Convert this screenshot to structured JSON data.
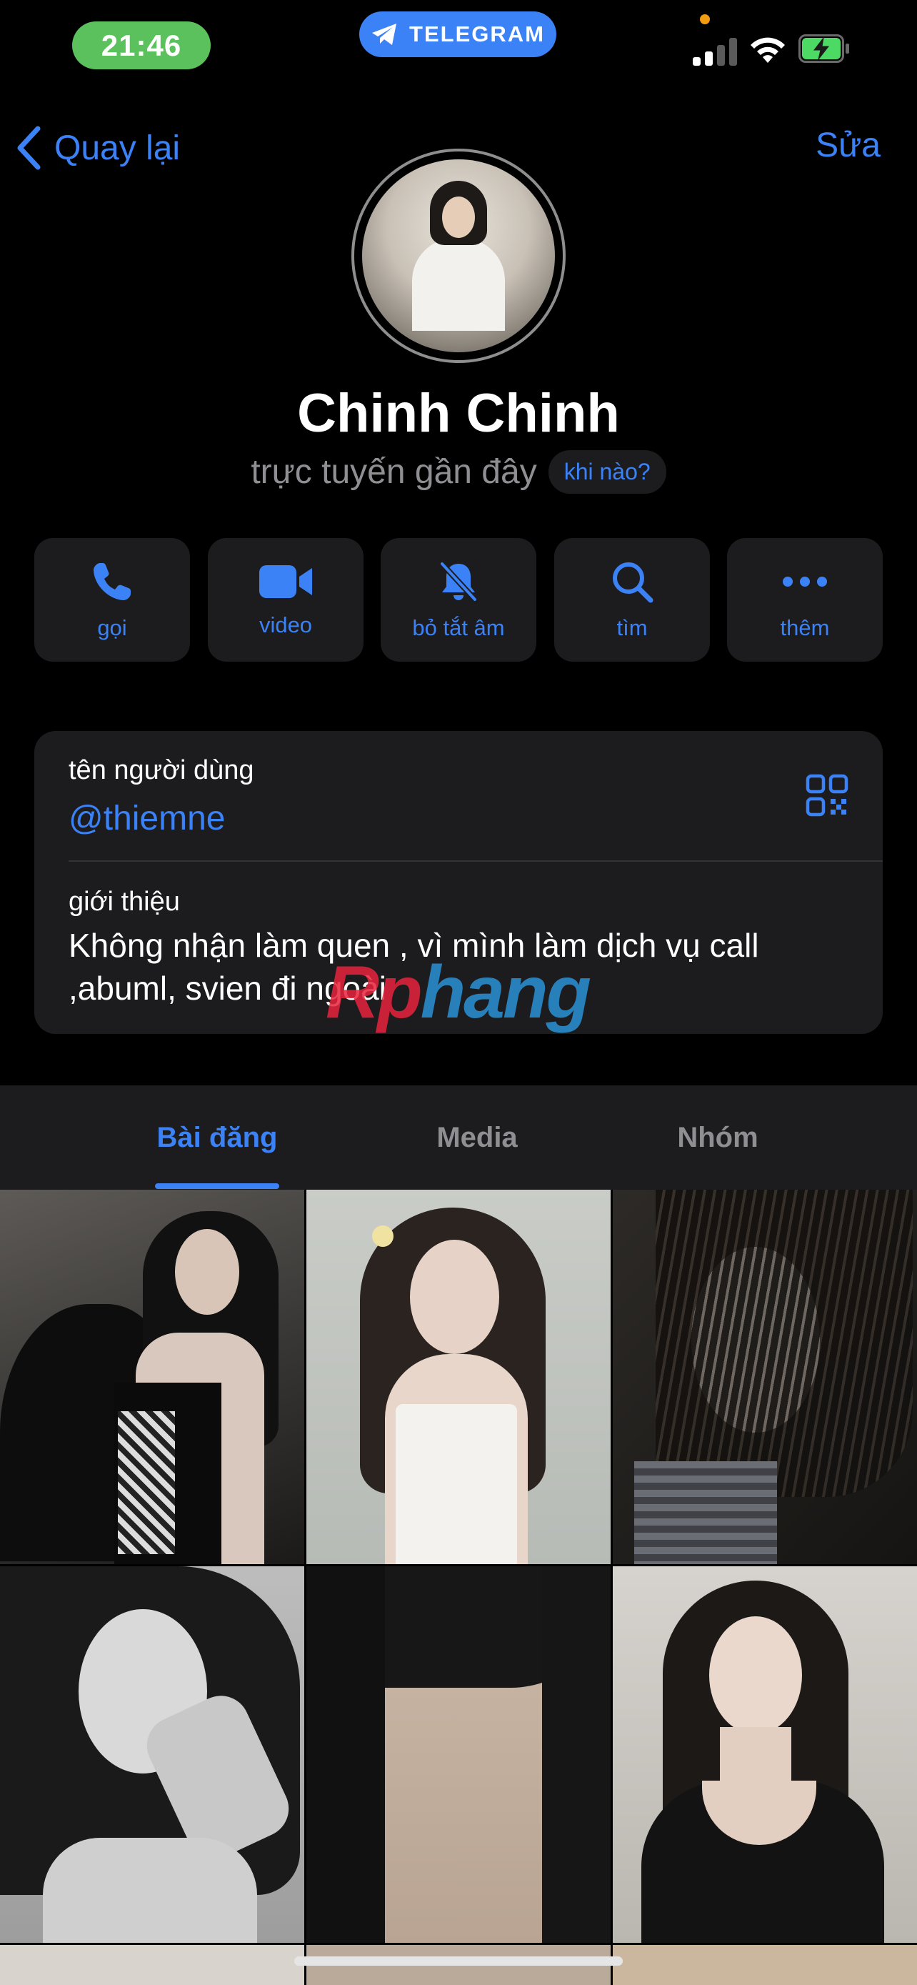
{
  "status_bar": {
    "time": "21:46",
    "app_pill": "TELEGRAM",
    "indicator_color": "#f39c12",
    "icons": [
      "telegram-icon",
      "signal-icon",
      "wifi-icon",
      "battery-charging-icon"
    ]
  },
  "nav": {
    "back_label": "Quay lại",
    "edit_label": "Sửa"
  },
  "profile": {
    "name": "Chinh Chinh",
    "status": "trực tuyến gần đây",
    "when_label": "khi nào?"
  },
  "actions": [
    {
      "label": "gọi",
      "icon": "phone-icon"
    },
    {
      "label": "video",
      "icon": "video-icon"
    },
    {
      "label": "bỏ tắt âm",
      "icon": "bell-slash-icon"
    },
    {
      "label": "tìm",
      "icon": "search-icon"
    },
    {
      "label": "thêm",
      "icon": "more-icon"
    }
  ],
  "info": {
    "username_label": "tên người dùng",
    "username_value": "@thiemne",
    "bio_label": "giới thiệu",
    "bio_text": "Không nhận làm quen , vì mình làm dịch vụ call ,abuml, svien đi ngoài"
  },
  "watermark": {
    "part_a": "Rp",
    "part_b": "hang"
  },
  "tabs": [
    {
      "label": "Bài đăng",
      "active": true
    },
    {
      "label": "Media",
      "active": false
    },
    {
      "label": "Nhóm",
      "active": false
    }
  ],
  "colors": {
    "accent": "#3b82f6",
    "background": "#000000",
    "card": "#1c1c1e",
    "time_pill": "#5ac15c"
  }
}
